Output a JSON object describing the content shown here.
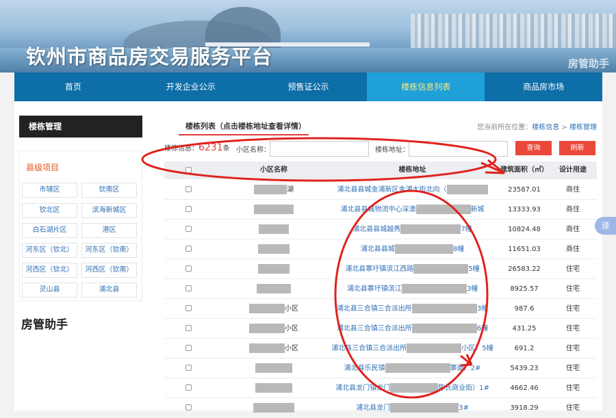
{
  "banner": {
    "title": "钦州市商品房交易服务平台",
    "helper": "房管助手"
  },
  "nav": [
    {
      "label": "首页",
      "active": false
    },
    {
      "label": "开发企业公示",
      "active": false
    },
    {
      "label": "预售证公示",
      "active": false
    },
    {
      "label": "楼栋信息列表",
      "active": true
    },
    {
      "label": "商品房市场",
      "active": false
    }
  ],
  "sidebar": {
    "heading": "楼栋管理",
    "subheading": "县级项目",
    "districts": [
      "市辖区",
      "钦南区",
      "钦北区",
      "滨海新城区",
      "白石湖片区",
      "港区",
      "河东区（钦北）",
      "河东区（钦南）",
      "河西区（钦北）",
      "河西区（钦南）",
      "灵山县",
      "浦北县"
    ],
    "footer": "房管助手"
  },
  "list": {
    "title": "楼栋列表（点击楼栋地址查看详情）",
    "breadcrumb_prefix": "您当前所在位置：",
    "breadcrumb_1": "楼栋信息",
    "breadcrumb_sep": " > ",
    "breadcrumb_2": "楼栋管理",
    "info_label": "楼栋信息：",
    "count": "6231",
    "count_unit": "条",
    "name_label": "小区名称：",
    "name_value": "",
    "addr_label": "楼栋地址：",
    "addr_value": "",
    "query_label": "查询",
    "refresh_label": "刷新"
  },
  "table": {
    "headers": [
      "小区名称",
      "楼栋地址",
      "建筑面积（㎡）",
      "设计用途"
    ],
    "rows": [
      {
        "name": "湖",
        "addr_pre": "浦北县县城金浦新区金浦大街北向（",
        "addr_post": "",
        "area": "23587.01",
        "use": "商住"
      },
      {
        "name": "",
        "addr_pre": "浦北县县城物流中心深澳",
        "addr_post": "新城",
        "area": "13333.93",
        "use": "商住"
      },
      {
        "name": "",
        "addr_pre": "浦北县县城越秀",
        "addr_post": "7幢",
        "area": "10824.48",
        "use": "商住"
      },
      {
        "name": "",
        "addr_pre": "浦北县县城",
        "addr_post": "8幢",
        "area": "11651.03",
        "use": "商住"
      },
      {
        "name": "",
        "addr_pre": "浦北县寨圩镇滨江西路",
        "addr_post": "5幢",
        "area": "26583.22",
        "use": "住宅"
      },
      {
        "name": "",
        "addr_pre": "浦北县寨圩镇滨江",
        "addr_post": "3幢",
        "area": "8925.57",
        "use": "住宅"
      },
      {
        "name": "小区",
        "addr_pre": "浦北县三合镇三合派出所",
        "addr_post": "3幢",
        "area": "987.6",
        "use": "住宅"
      },
      {
        "name": "小区",
        "addr_pre": "浦北县三合镇三合派出所",
        "addr_post": "6幢",
        "area": "431.25",
        "use": "住宅"
      },
      {
        "name": "小区",
        "addr_pre": "浦北县三合镇三合派出所",
        "addr_post": "小区）5幢",
        "area": "691.2",
        "use": "住宅"
      },
      {
        "name": "",
        "addr_pre": "浦北县乐民镇",
        "addr_post": "寨面）2#",
        "area": "5439.23",
        "use": "住宅"
      },
      {
        "name": "",
        "addr_pre": "浦北县龙门镇龙门",
        "addr_post": "陈氏商业街）1#",
        "area": "4662.46",
        "use": "住宅"
      },
      {
        "name": "",
        "addr_pre": "浦北县龙门",
        "addr_post": "3#",
        "area": "3918.29",
        "use": "住宅"
      }
    ]
  },
  "translate_label": "译",
  "colors": {
    "nav": "#0d6ea8",
    "nav_active": "#1fa0d8",
    "accent": "#e03a3a",
    "link": "#2f6fb5",
    "annotation": "#e0221c"
  }
}
